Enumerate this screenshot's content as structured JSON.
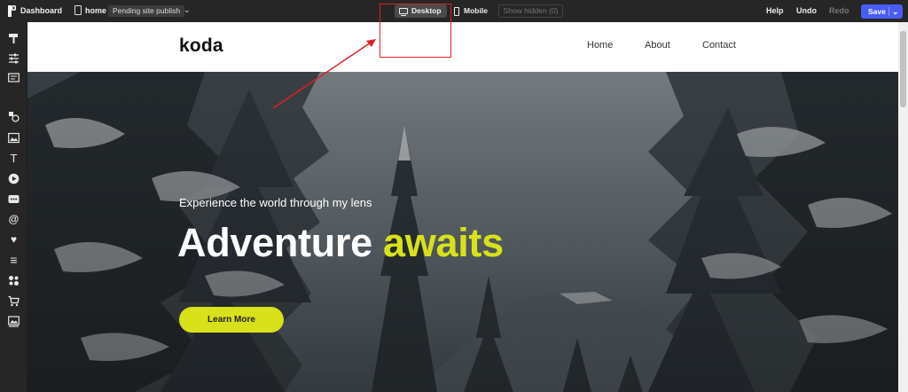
{
  "topbar": {
    "dashboard_label": "Dashboard",
    "page_name": "home",
    "publish_status": "Pending site publish",
    "chevron": "⌄",
    "device_desktop": "Desktop",
    "device_mobile": "Mobile",
    "show_hidden": "Show hidden (0)",
    "help": "Help",
    "undo": "Undo",
    "redo": "Redo",
    "save": "Save",
    "save_caret": "⌄",
    "accent_color": "#4a5cf6"
  },
  "sidebar": {
    "icons": [
      "paint-roller-icon",
      "sliders-icon",
      "layout-icon",
      "shapes-icon",
      "image-icon",
      "text-icon",
      "play-icon",
      "comment-icon",
      "at-sign-icon",
      "heart-icon",
      "list-icon",
      "apps-icon",
      "cart-icon",
      "gallery-icon"
    ],
    "glyphs": {
      "text": "T",
      "play": "▶",
      "comment": "…",
      "at": "@",
      "heart": "♥",
      "list": "≡",
      "cart": "🛒"
    }
  },
  "site": {
    "brand": "koda",
    "nav": [
      "Home",
      "About",
      "Contact"
    ],
    "hero": {
      "tagline": "Experience the world through my lens",
      "headline_main": "Adventure",
      "headline_accent": "awaits",
      "cta": "Learn More",
      "accent_color": "#d8e11a"
    }
  },
  "annotation": {
    "color": "#e02020",
    "target": "device_desktop"
  }
}
